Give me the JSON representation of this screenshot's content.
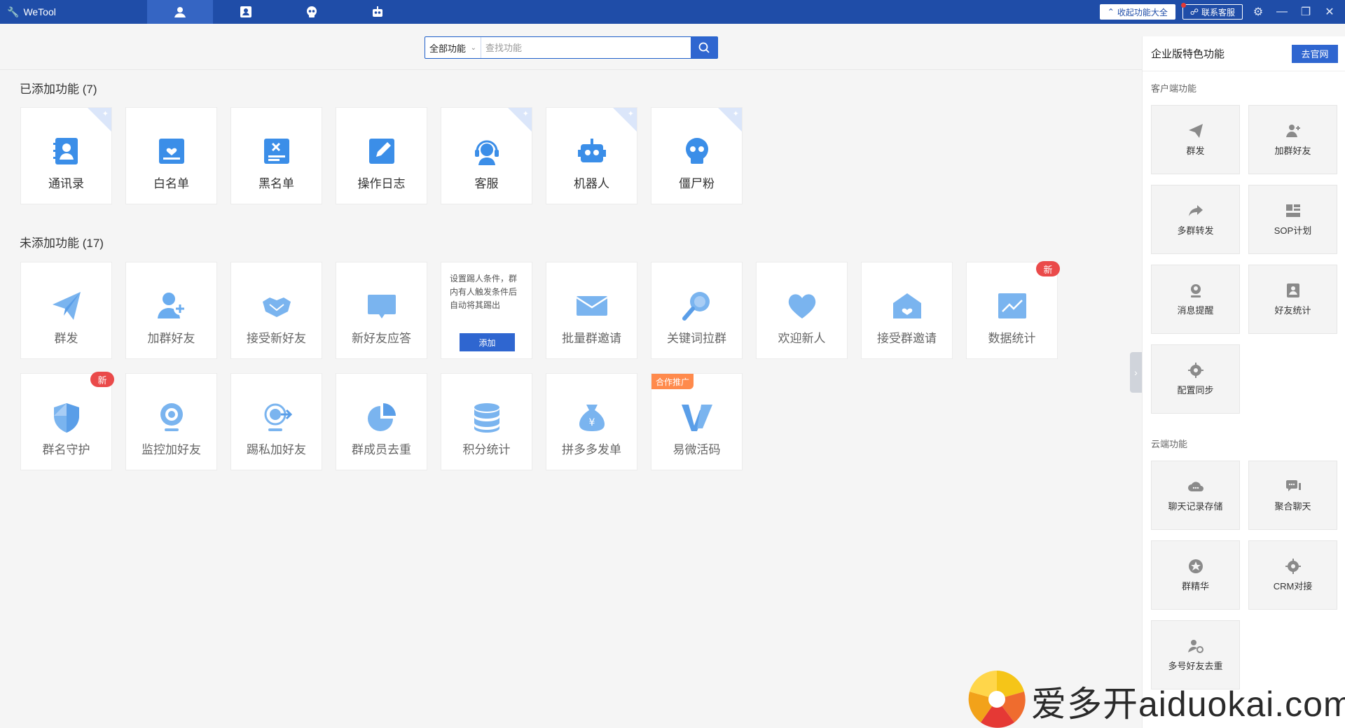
{
  "app": {
    "title": "WeTool"
  },
  "titlebar": {
    "collapse_label": "收起功能大全",
    "contact_label": "联系客服"
  },
  "search": {
    "scope": "全部功能",
    "placeholder": "查找功能"
  },
  "added": {
    "title": "已添加功能 (7)",
    "items": [
      {
        "label": "通讯录",
        "icon": "contacts-icon"
      },
      {
        "label": "白名单",
        "icon": "whitelist-icon"
      },
      {
        "label": "黑名单",
        "icon": "blacklist-icon"
      },
      {
        "label": "操作日志",
        "icon": "log-icon"
      },
      {
        "label": "客服",
        "icon": "customer-service-icon"
      },
      {
        "label": "机器人",
        "icon": "robot-icon"
      },
      {
        "label": "僵尸粉",
        "icon": "skull-icon"
      }
    ]
  },
  "not_added": {
    "title": "未添加功能 (17)",
    "items": [
      {
        "label": "群发",
        "icon": "send-icon"
      },
      {
        "label": "加群好友",
        "icon": "add-friend-icon"
      },
      {
        "label": "接受新好友",
        "icon": "handshake-icon"
      },
      {
        "label": "新好友应答",
        "icon": "chat-bubble-icon"
      },
      {
        "label": "群成员去重",
        "icon": "pie-icon"
      },
      {
        "label": "批量群邀请",
        "icon": "mail-icon"
      },
      {
        "label": "关键词拉群",
        "icon": "magnifier-icon"
      },
      {
        "label": "欢迎新人",
        "icon": "heart-icon"
      },
      {
        "label": "接受群邀请",
        "icon": "open-mail-icon"
      },
      {
        "label": "数据统计",
        "icon": "chart-icon"
      },
      {
        "label": "群名守护",
        "icon": "shield-icon"
      },
      {
        "label": "监控加好友",
        "icon": "webcam-icon"
      },
      {
        "label": "踢私加好友",
        "icon": "kick-icon"
      },
      {
        "label": "积分统计",
        "icon": "database-icon"
      },
      {
        "label": "拼多多发单",
        "icon": "money-bag-icon"
      },
      {
        "label": "易微活码",
        "icon": "yiwei-logo-icon"
      }
    ],
    "hover_card": {
      "desc": "设置踢人条件，群内有人触发条件后自动将其踢出",
      "add_label": "添加"
    },
    "badge_new": "新",
    "badge_coop": "合作推广"
  },
  "right_panel": {
    "title": "企业版特色功能",
    "website_btn": "去官网",
    "client_section": "客户端功能",
    "client_items": [
      {
        "label": "群发",
        "icon": "send-icon"
      },
      {
        "label": "加群好友",
        "icon": "add-friend-icon"
      },
      {
        "label": "多群转发",
        "icon": "forward-icon"
      },
      {
        "label": "SOP计划",
        "icon": "plan-icon"
      },
      {
        "label": "消息提醒",
        "icon": "reminder-icon"
      },
      {
        "label": "好友统计",
        "icon": "friend-stats-icon"
      },
      {
        "label": "配置同步",
        "icon": "gear-icon"
      }
    ],
    "cloud_section": "云端功能",
    "cloud_items": [
      {
        "label": "聊天记录存储",
        "icon": "cloud-chat-icon"
      },
      {
        "label": "聚合聊天",
        "icon": "aggregate-chat-icon"
      },
      {
        "label": "群精华",
        "icon": "star-icon"
      },
      {
        "label": "CRM对接",
        "icon": "gear-icon"
      },
      {
        "label": "多号好友去重",
        "icon": "dedupe-icon"
      }
    ]
  },
  "watermark": {
    "text": "爱多开aiduokai.com"
  },
  "colors": {
    "brand": "#1f4da8",
    "accent": "#2f66d0",
    "icon_blue": "#3b8ee8",
    "badge_red": "#ea4a4a",
    "badge_orange": "#ff8a4c"
  }
}
